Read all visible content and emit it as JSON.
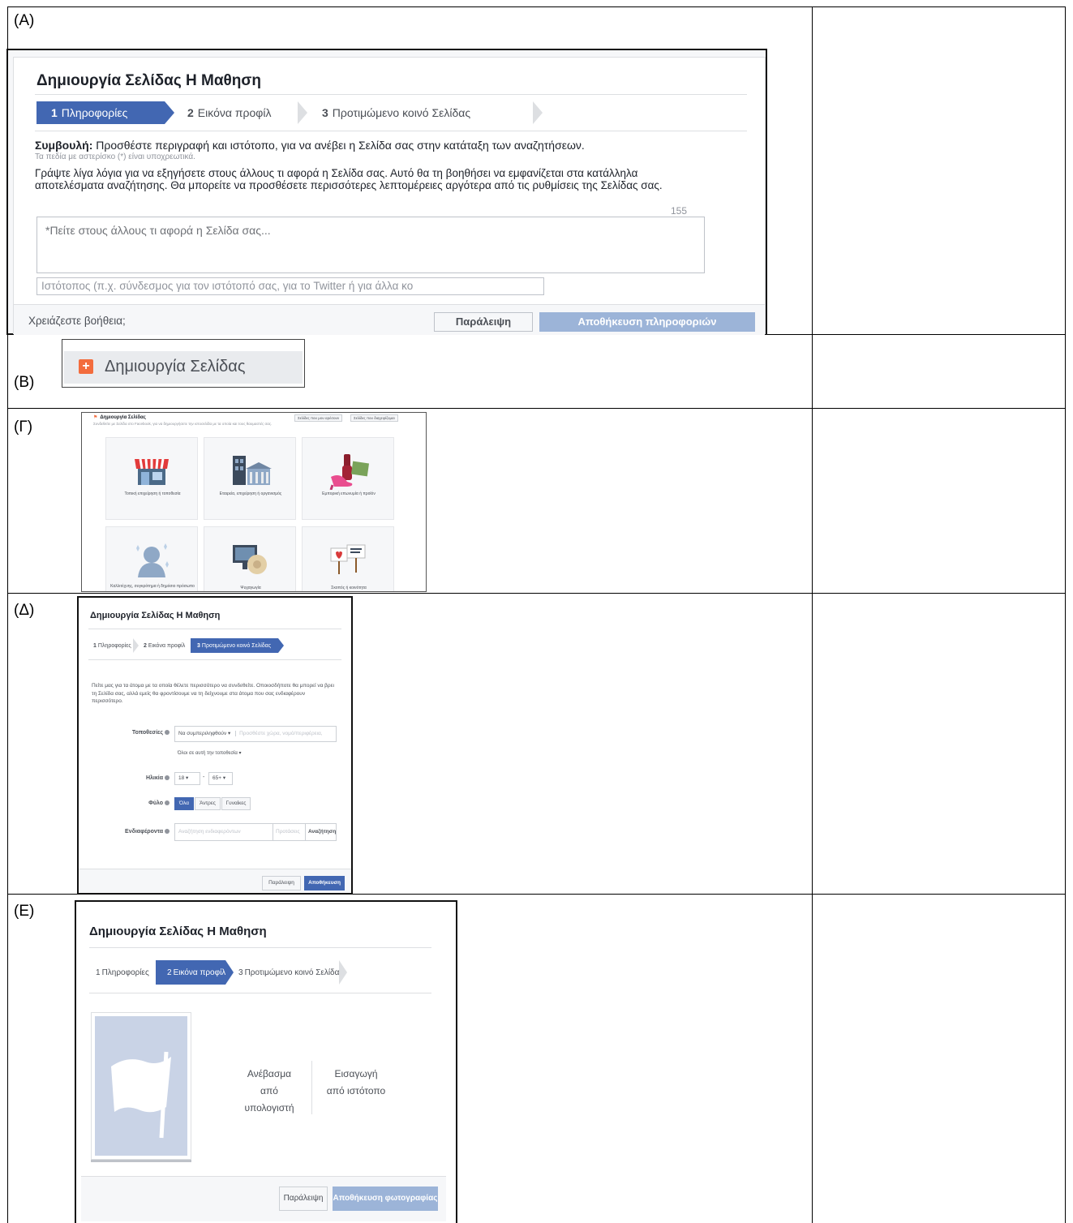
{
  "labels": {
    "a": "(A)",
    "b": "(B)",
    "g": "(Γ)",
    "d": "(Δ)",
    "e": "(Ε)"
  },
  "colors": {
    "accent": "#4267b2",
    "accent_disabled": "#9cb4d8",
    "panel_bg": "#f6f7f9",
    "border": "#dddfe2"
  },
  "panel_a": {
    "title": "Δημιουργία Σελίδας Η Μαθηση",
    "steps": [
      {
        "num": "1",
        "label": "Πληροφορίες",
        "active": true
      },
      {
        "num": "2",
        "label": "Εικόνα προφίλ",
        "active": false
      },
      {
        "num": "3",
        "label": "Προτιμώμενο κοινό Σελίδας",
        "active": false
      }
    ],
    "tip_bold": "Συμβουλή:",
    "tip_text": " Προσθέστε περιγραφή και ιστότοπο, για να ανέβει η Σελίδα σας στην κατάταξη των αναζητήσεων.",
    "required_note": "Τα πεδία με αστερίσκο (*) είναι υποχρεωτικά.",
    "description": "Γράψτε λίγα λόγια για να εξηγήσετε στους άλλους τι αφορά η Σελίδα σας. Αυτό θα τη βοηθήσει να εμφανίζεται στα κατάλληλα αποτελέσματα αναζήτησης. Θα μπορείτε να προσθέσετε περισσότερες λεπτομέρειες αργότερα από τις ρυθμίσεις της Σελίδας σας.",
    "char_count": "155",
    "about_placeholder": "*Πείτε στους άλλους τι αφορά η Σελίδα σας...",
    "website_placeholder": "Ιστότοπος (π.χ. σύνδεσμος για τον ιστότοπό σας, για το Twitter ή για άλλα κο",
    "help_link": "Χρειάζεστε βοήθεια;",
    "skip_label": "Παράλειψη",
    "save_label": "Αποθήκευση πληροφοριών"
  },
  "panel_b": {
    "button_label": "Δημιουργία Σελίδας",
    "icon": "create-page-icon"
  },
  "panel_g": {
    "header": "Δημιουργία Σελίδας",
    "subheader": "Συνδεθείτε με Σελίδα στο Facebook, για να δημιουργήσετε την ιστοσελίδα με τα οποία και τους θαυμαστές σας.",
    "top_buttons": [
      "Σελίδες που μου αρέσουν",
      "Σελίδες που διαχειρίζομαι"
    ],
    "categories": [
      {
        "label": "Τοπική επιχείρηση ή τοποθεσία",
        "icon": "storefront-icon"
      },
      {
        "label": "Εταιρεία, επιχείρηση ή οργανισμός",
        "icon": "building-icon"
      },
      {
        "label": "Εμπορική επωνυμία ή προϊόν",
        "icon": "products-icon"
      },
      {
        "label": "Καλλιτέχνης, συγκρότημα ή δημόσιο πρόσωπο",
        "icon": "person-icon"
      },
      {
        "label": "Ψυχαγωγία",
        "icon": "entertainment-icon"
      },
      {
        "label": "Σκοπός ή κοινότητα",
        "icon": "cause-icon"
      }
    ]
  },
  "panel_d": {
    "title": "Δημιουργία Σελίδας Η Μαθηση",
    "steps": [
      {
        "num": "1",
        "label": "Πληροφορίες",
        "active": false
      },
      {
        "num": "2",
        "label": "Εικόνα προφίλ",
        "active": false
      },
      {
        "num": "3",
        "label": "Προτιμώμενο κοινό Σελίδας",
        "active": true
      }
    ],
    "intro": "Πείτε μας για τα άτομα με τα οποία θέλετε περισσότερο να συνδεθείτε. Οποιοσδήποτε θα μπορεί να βρει τη Σελίδα σας, αλλά εμείς θα φροντίσουμε να τη δείχνουμε στα άτομα που σας ενδιαφέρουν περισσότερο.",
    "locations_label": "Τοποθεσίες",
    "locations_mode": "Να συμπεριληφθούν ▾",
    "locations_placeholder": "Προσθέστε χώρα, νομό/περιφέρεια,",
    "locations_scope": "Όλοι σε αυτή την τοποθεσία ▾",
    "age_label": "Ηλικία",
    "age_min": "18 ▾",
    "age_dash": "-",
    "age_max": "65+ ▾",
    "gender_label": "Φύλο",
    "gender_options": [
      "Όλα",
      "Άντρες",
      "Γυναίκες"
    ],
    "interests_label": "Ενδιαφέροντα",
    "interests_placeholder": "Αναζήτηση ενδιαφερόντων",
    "suggestions": "Προτάσεις",
    "search": "Αναζήτηση",
    "skip_label": "Παράλειψη",
    "save_label": "Αποθήκευση"
  },
  "panel_e": {
    "title": "Δημιουργία Σελίδας Η Μαθηση",
    "steps": [
      {
        "num": "1",
        "label": "Πληροφορίες",
        "active": false
      },
      {
        "num": "2",
        "label": "Εικόνα προφίλ",
        "active": true
      },
      {
        "num": "3",
        "label": "Προτιμώμενο κοινό Σελίδας",
        "active": false
      }
    ],
    "upload_lines": [
      "Ανέβασμα",
      "από",
      "υπολογιστή"
    ],
    "import_lines": [
      "Εισαγωγή",
      "από ιστότοπο"
    ],
    "skip_label": "Παράλειψη",
    "save_label": "Αποθήκευση φωτογραφίας"
  }
}
